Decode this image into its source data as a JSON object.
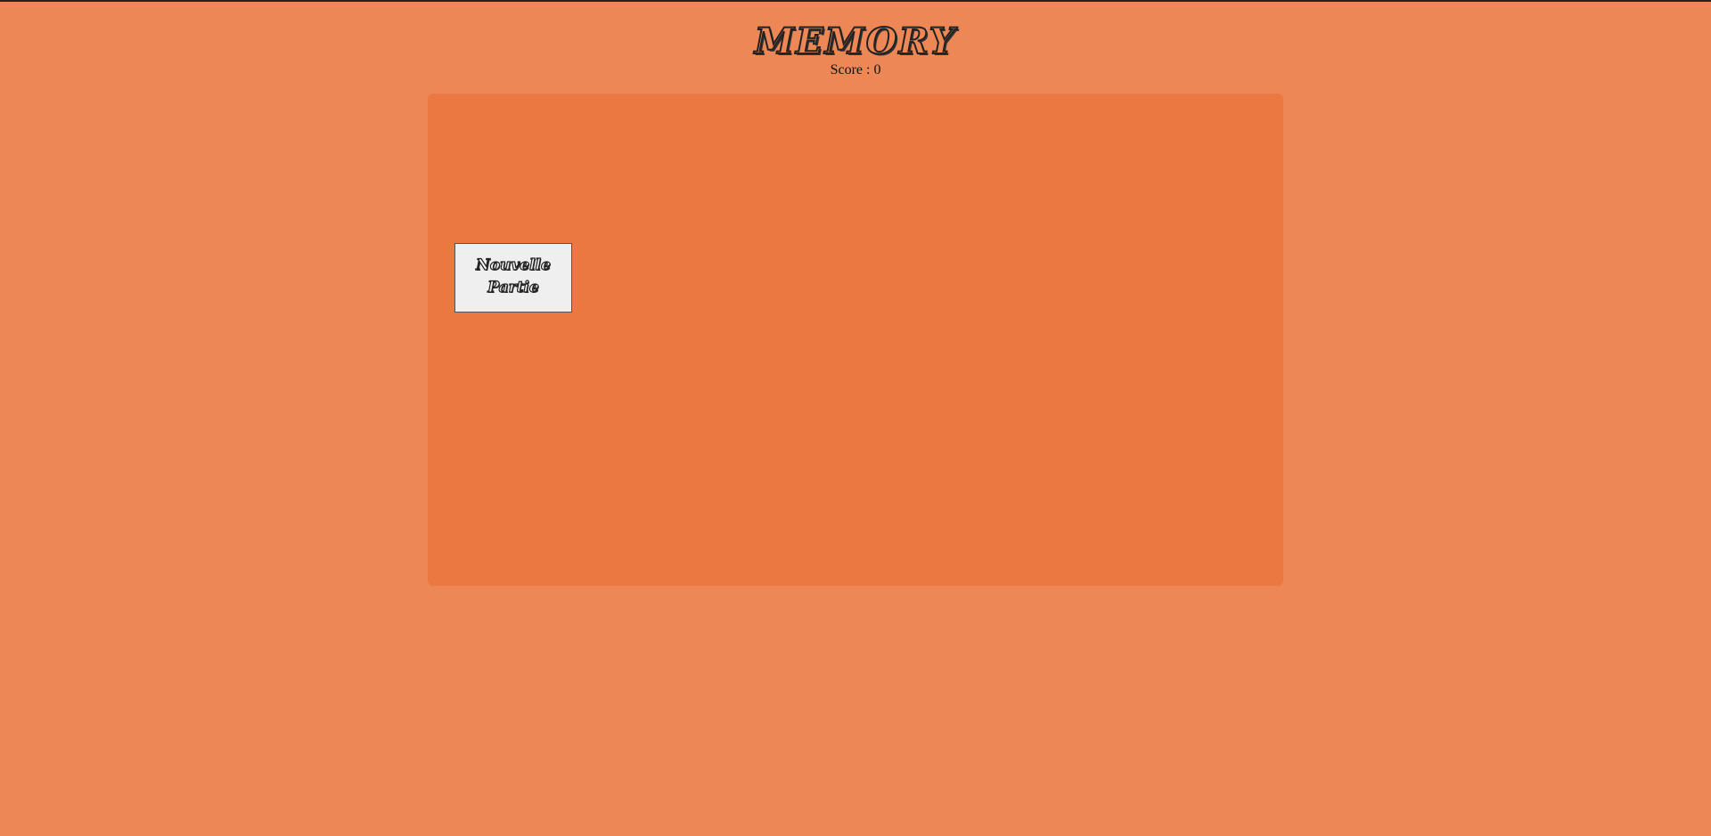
{
  "header": {
    "title": "MEMORY",
    "score": "Score : 0"
  },
  "board": {
    "new_game_label": "Nouvelle Partie"
  },
  "colors": {
    "page_background": "#ed8756",
    "board_background": "#eb7841",
    "button_background": "#efefef"
  }
}
